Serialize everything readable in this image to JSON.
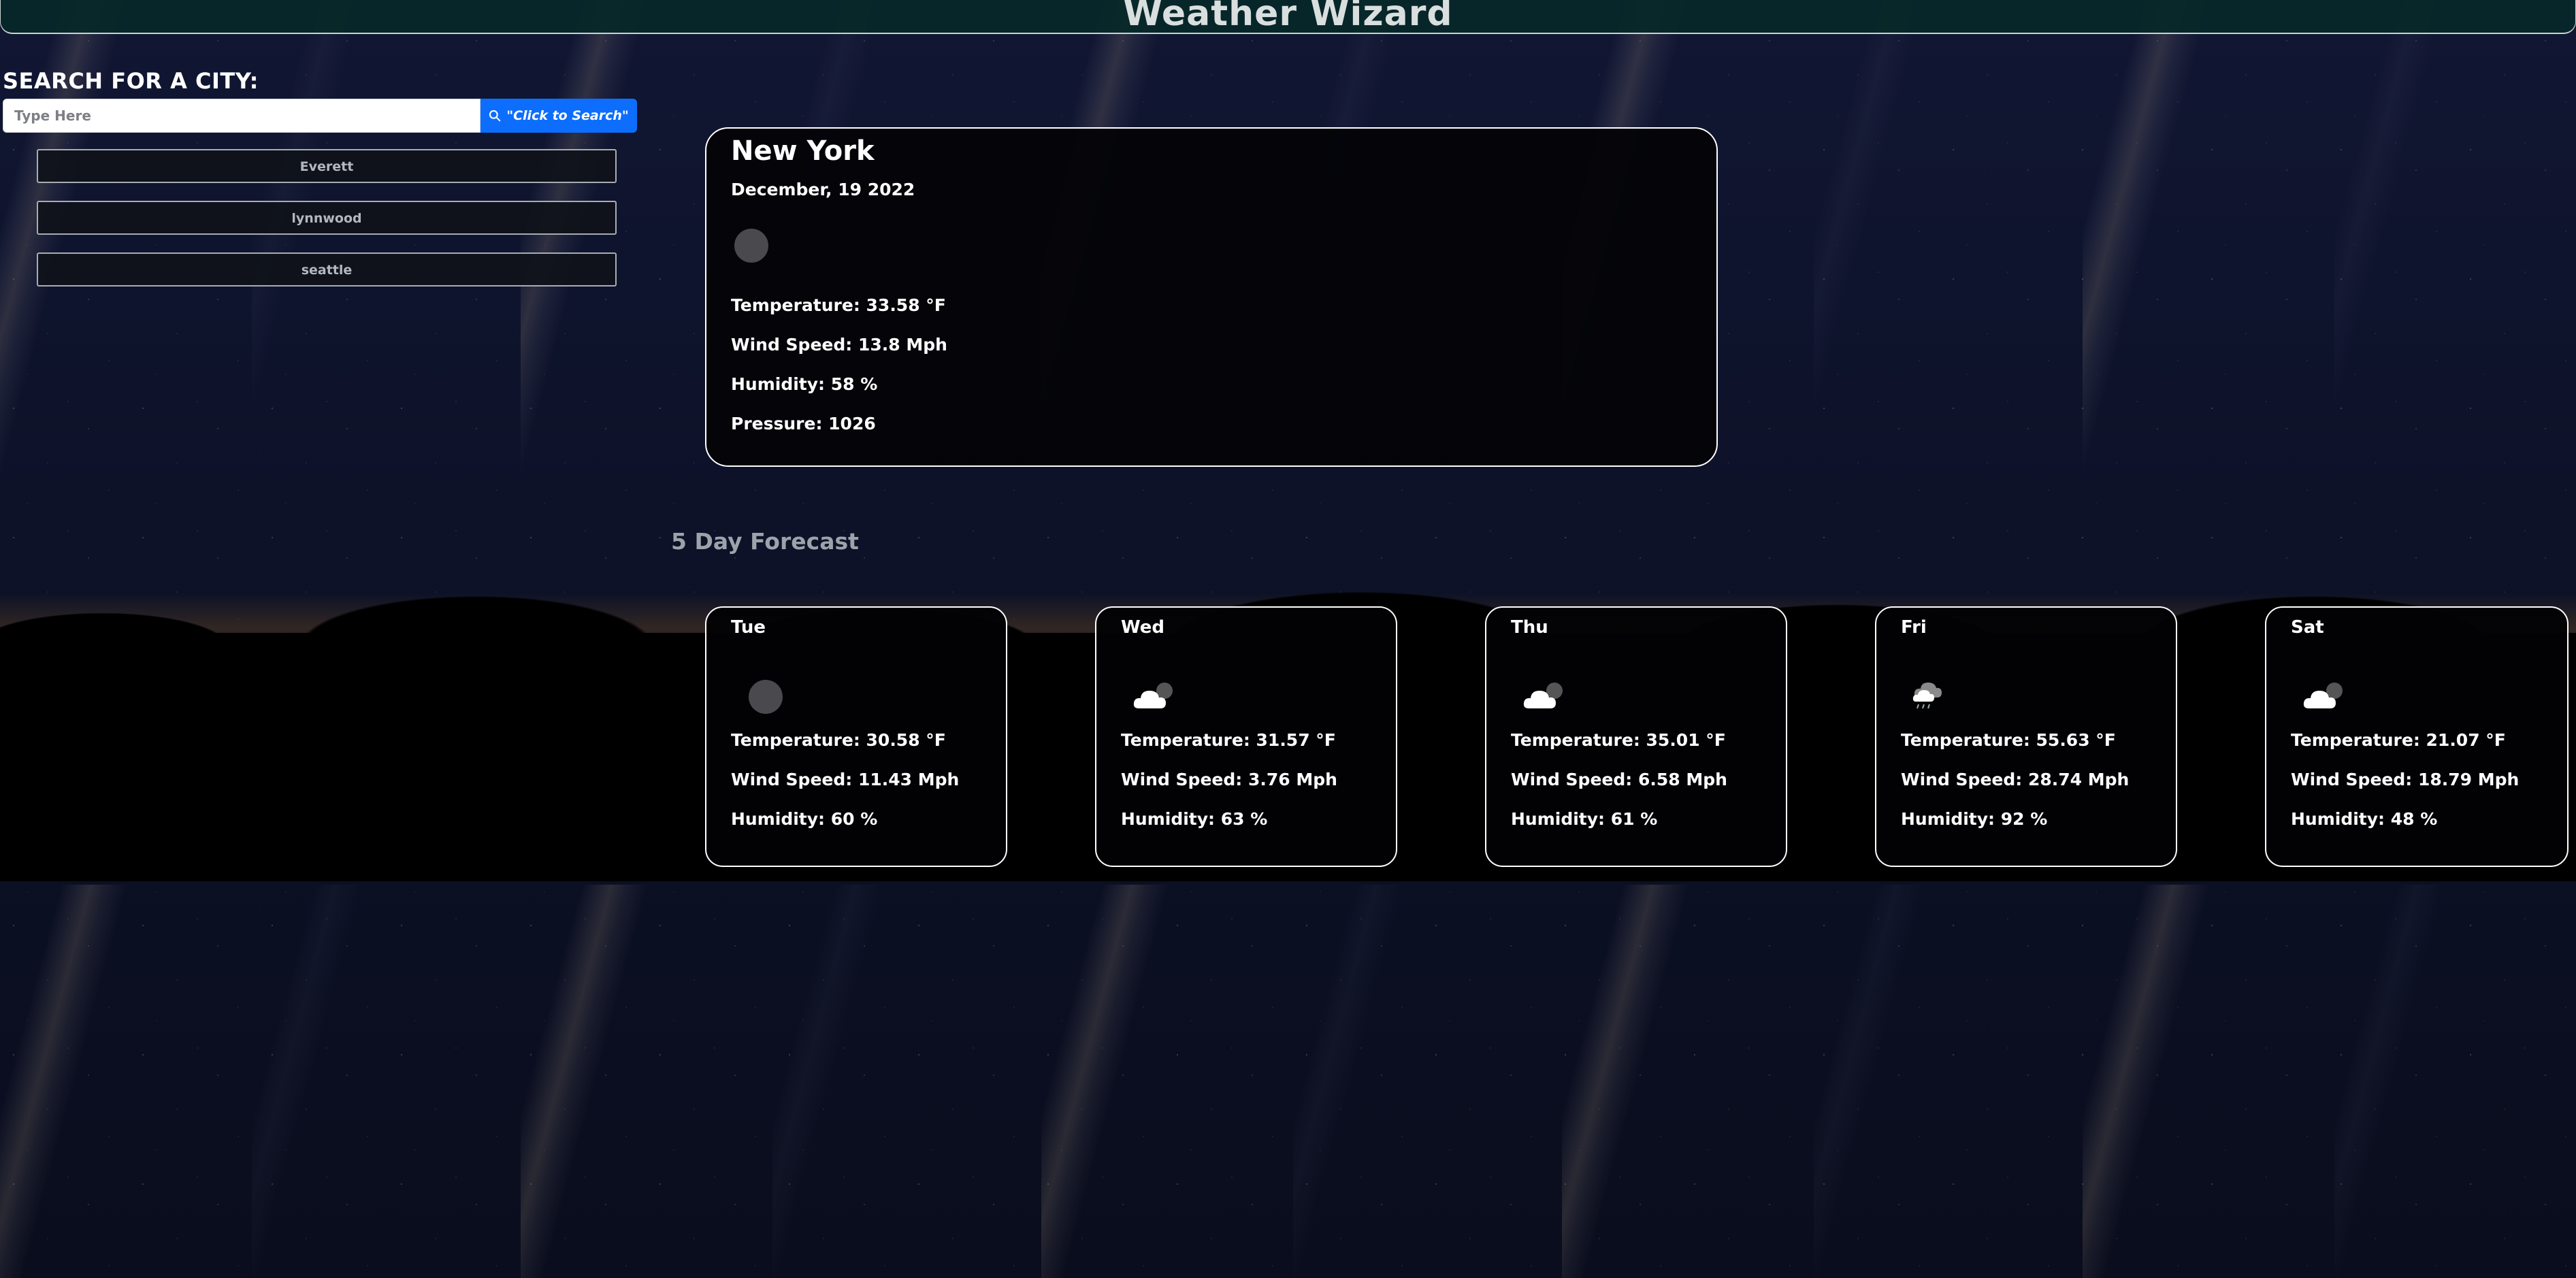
{
  "header": {
    "title": "Weather Wizard"
  },
  "search": {
    "label": "SEARCH FOR A CITY:",
    "placeholder": "Type Here",
    "value": "",
    "button_label": "\"Click to Search\"",
    "button_icon": "search-icon",
    "accent_color": "#0d6efd"
  },
  "history": {
    "items": [
      {
        "label": "Everett"
      },
      {
        "label": "lynnwood"
      },
      {
        "label": "seattle"
      }
    ]
  },
  "current": {
    "city": "New York",
    "date": "December, 19 2022",
    "icon": "moon-icon",
    "temperature": "Temperature: 33.58 °F",
    "wind": "Wind Speed: 13.8 Mph",
    "humidity": "Humidity: 58 %",
    "pressure": "Pressure: 1026"
  },
  "forecast": {
    "title": "5 Day Forecast",
    "days": [
      {
        "day": "Tue",
        "icon": "moon-icon",
        "temperature": "Temperature: 30.58 °F",
        "wind": "Wind Speed: 11.43 Mph",
        "humidity": "Humidity: 60 %"
      },
      {
        "day": "Wed",
        "icon": "cloud-icon",
        "temperature": "Temperature: 31.57 °F",
        "wind": "Wind Speed: 3.76 Mph",
        "humidity": "Humidity: 63 %"
      },
      {
        "day": "Thu",
        "icon": "cloud-icon",
        "temperature": "Temperature: 35.01 °F",
        "wind": "Wind Speed: 6.58 Mph",
        "humidity": "Humidity: 61 %"
      },
      {
        "day": "Fri",
        "icon": "rain-cloud-icon",
        "temperature": "Temperature: 55.63 °F",
        "wind": "Wind Speed: 28.74 Mph",
        "humidity": "Humidity: 92 %"
      },
      {
        "day": "Sat",
        "icon": "cloud-icon",
        "temperature": "Temperature: 21.07 °F",
        "wind": "Wind Speed: 18.79 Mph",
        "humidity": "Humidity: 48 %"
      }
    ]
  }
}
